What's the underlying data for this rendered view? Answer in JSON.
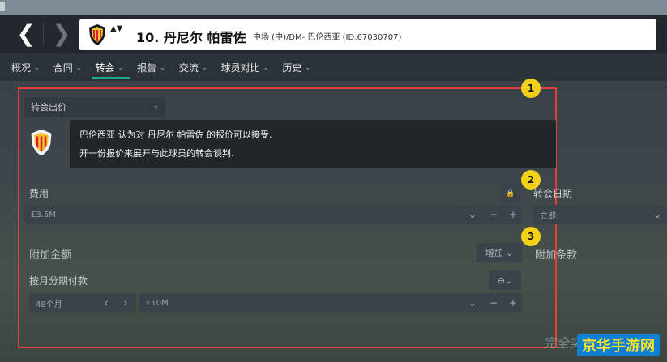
{
  "header": {
    "back_glyph": "❮",
    "forward_glyph": "❯",
    "player_name": "10. 丹尼尔 帕雷佐",
    "player_info": "中场 (中)/DM- 巴伦西亚 (ID:67030707)",
    "updown_glyph": "▲▼"
  },
  "tabs": [
    {
      "label": "概况"
    },
    {
      "label": "合同"
    },
    {
      "label": "转会"
    },
    {
      "label": "报告"
    },
    {
      "label": "交流"
    },
    {
      "label": "球员对比"
    },
    {
      "label": "历史"
    }
  ],
  "caret": "⌄",
  "offer_dropdown": "转会出价",
  "message": {
    "line1": "巴伦西亚 认为对 丹尼尔 帕雷佐 的报价可以接受.",
    "line2": "开一份报价来展开与此球员的转会谈判."
  },
  "fee": {
    "label": "费用",
    "value": "£3.5M",
    "lock_icon": "🔒",
    "chevron": "⌄",
    "minus": "−",
    "plus": "+"
  },
  "transfer_date": {
    "label": "转会日期",
    "value": "立即",
    "chevron": "⌄"
  },
  "add_amount": {
    "label": "附加金额",
    "add_button": "增加 ⌄"
  },
  "add_clause": {
    "label": "附加条款"
  },
  "monthly": {
    "label": "按月分期付款",
    "months_value": "48个月",
    "amount_value": "£10M",
    "toggle": "⊖⌄",
    "prev": "‹",
    "next": "›",
    "chevron": "⌄",
    "minus": "−",
    "plus": "+"
  },
  "badges": [
    "1",
    "2",
    "3"
  ],
  "watermark": {
    "text": "完全实况M论坛",
    "logo": "京华手游网"
  },
  "colors": {
    "accent": "#19a889",
    "highlight_box": "#e53d3b",
    "badge": "#f2d11b"
  }
}
